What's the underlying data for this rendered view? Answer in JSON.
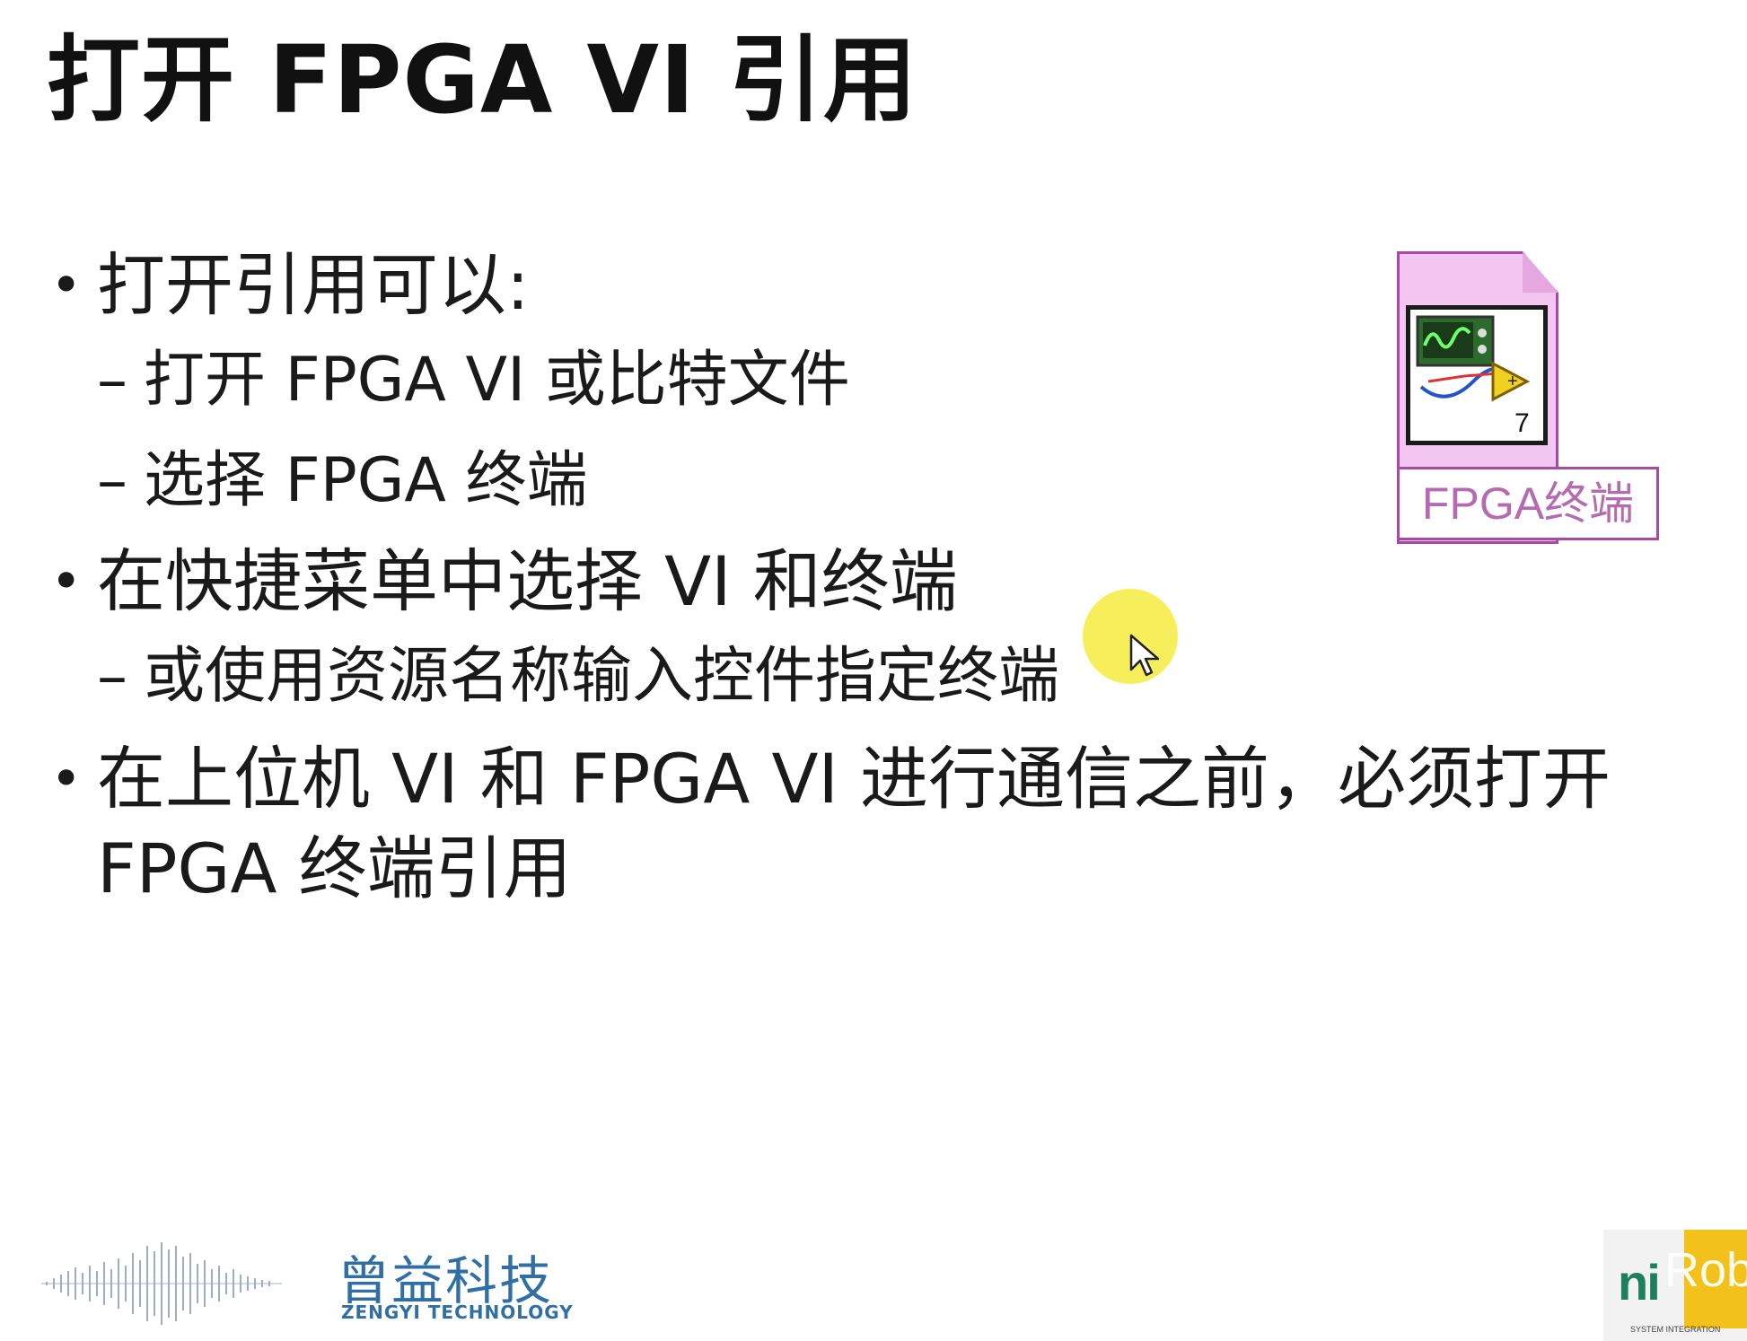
{
  "slide": {
    "title": "打开 FPGA VI 引用",
    "bullets": [
      {
        "text": "打开引用可以:",
        "subs": [
          "打开 FPGA VI 或比特文件",
          "选择 FPGA 终端"
        ]
      },
      {
        "text": "在快捷菜单中选择 VI 和终端",
        "subs": [
          "或使用资源名称输入控件指定终端"
        ]
      },
      {
        "text": "在上位机 VI 和 FPGA VI 进行通信之前，必须打开FPGA 终端引用",
        "subs": []
      }
    ],
    "bullet_glyph": "•",
    "sub_glyph": "–"
  },
  "vi_icon": {
    "label": "FPGA终端",
    "number": "7",
    "border_color": "#a64aa3",
    "fill_color": "#f2c6f0"
  },
  "footer": {
    "brand_cn": "曾益科技",
    "brand_en": "ZENGYI TECHNOLOGY",
    "ni_logo": "ni",
    "ni_subtext": "SYSTEM INTEGRATION",
    "watermark": "Rob"
  },
  "colors": {
    "text": "#1a1a1a",
    "brand": "#2f6fa4",
    "cursor_highlight": "#f5ec3e"
  }
}
